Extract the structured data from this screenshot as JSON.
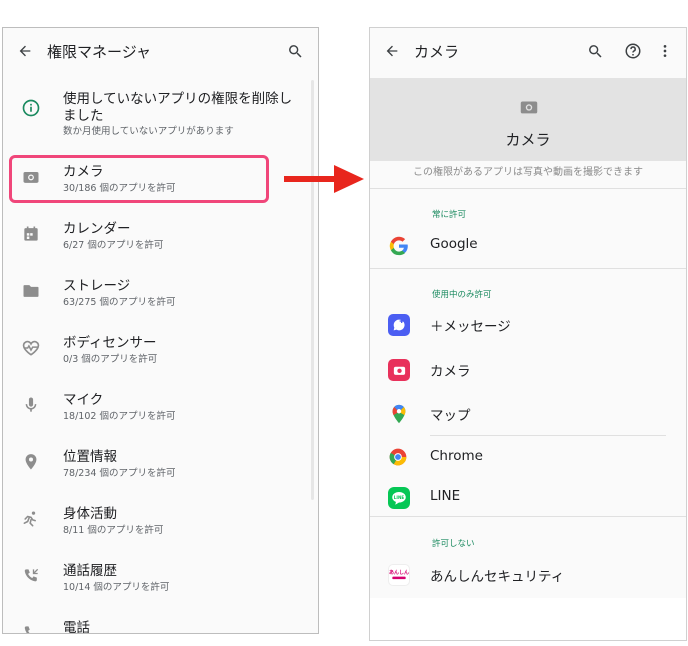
{
  "left": {
    "title": "権限マネージャ",
    "rows": [
      {
        "label": "使用していないアプリの権限を削除し",
        "label2": "ました",
        "sub": "数か月使用していないアプリがあります",
        "icon": "info-icon"
      },
      {
        "label": "カメラ",
        "sub": "30/186 個のアプリを許可",
        "icon": "camera-icon"
      },
      {
        "label": "カレンダー",
        "sub": "6/27 個のアプリを許可",
        "icon": "calendar-icon"
      },
      {
        "label": "ストレージ",
        "sub": "63/275 個のアプリを許可",
        "icon": "folder-icon"
      },
      {
        "label": "ボディセンサー",
        "sub": "0/3 個のアプリを許可",
        "icon": "heart-pulse-icon"
      },
      {
        "label": "マイク",
        "sub": "18/102 個のアプリを許可",
        "icon": "microphone-icon"
      },
      {
        "label": "位置情報",
        "sub": "78/234 個のアプリを許可",
        "icon": "location-icon"
      },
      {
        "label": "身体活動",
        "sub": "8/11 個のアプリを許可",
        "icon": "activity-icon"
      },
      {
        "label": "通話履歴",
        "sub": "10/14 個のアプリを許可",
        "icon": "call-log-icon"
      },
      {
        "label": "電話",
        "sub": "",
        "icon": "phone-icon"
      }
    ]
  },
  "right": {
    "title": "カメラ",
    "header_name": "カメラ",
    "description": "この権限があるアプリは写真や動画を撮影できます",
    "sections": [
      {
        "label": "常に許可",
        "apps": [
          "Google"
        ]
      },
      {
        "label": "使用中のみ許可",
        "apps": [
          "＋メッセージ",
          "カメラ",
          "マップ",
          "Chrome",
          "LINE"
        ]
      },
      {
        "label": "許可しない",
        "apps": [
          "あんしんセキュリティ"
        ]
      }
    ]
  },
  "icons": {
    "back": "arrow-back-icon",
    "search": "search-icon",
    "help": "help-icon",
    "more": "more-vert-icon"
  },
  "colors": {
    "accent_green": "#1a8a5f",
    "highlight": "#f0467a",
    "arrow_red": "#e8261d",
    "header_band": "#e3e3e3"
  },
  "anshin_logo_text": "あんしん"
}
